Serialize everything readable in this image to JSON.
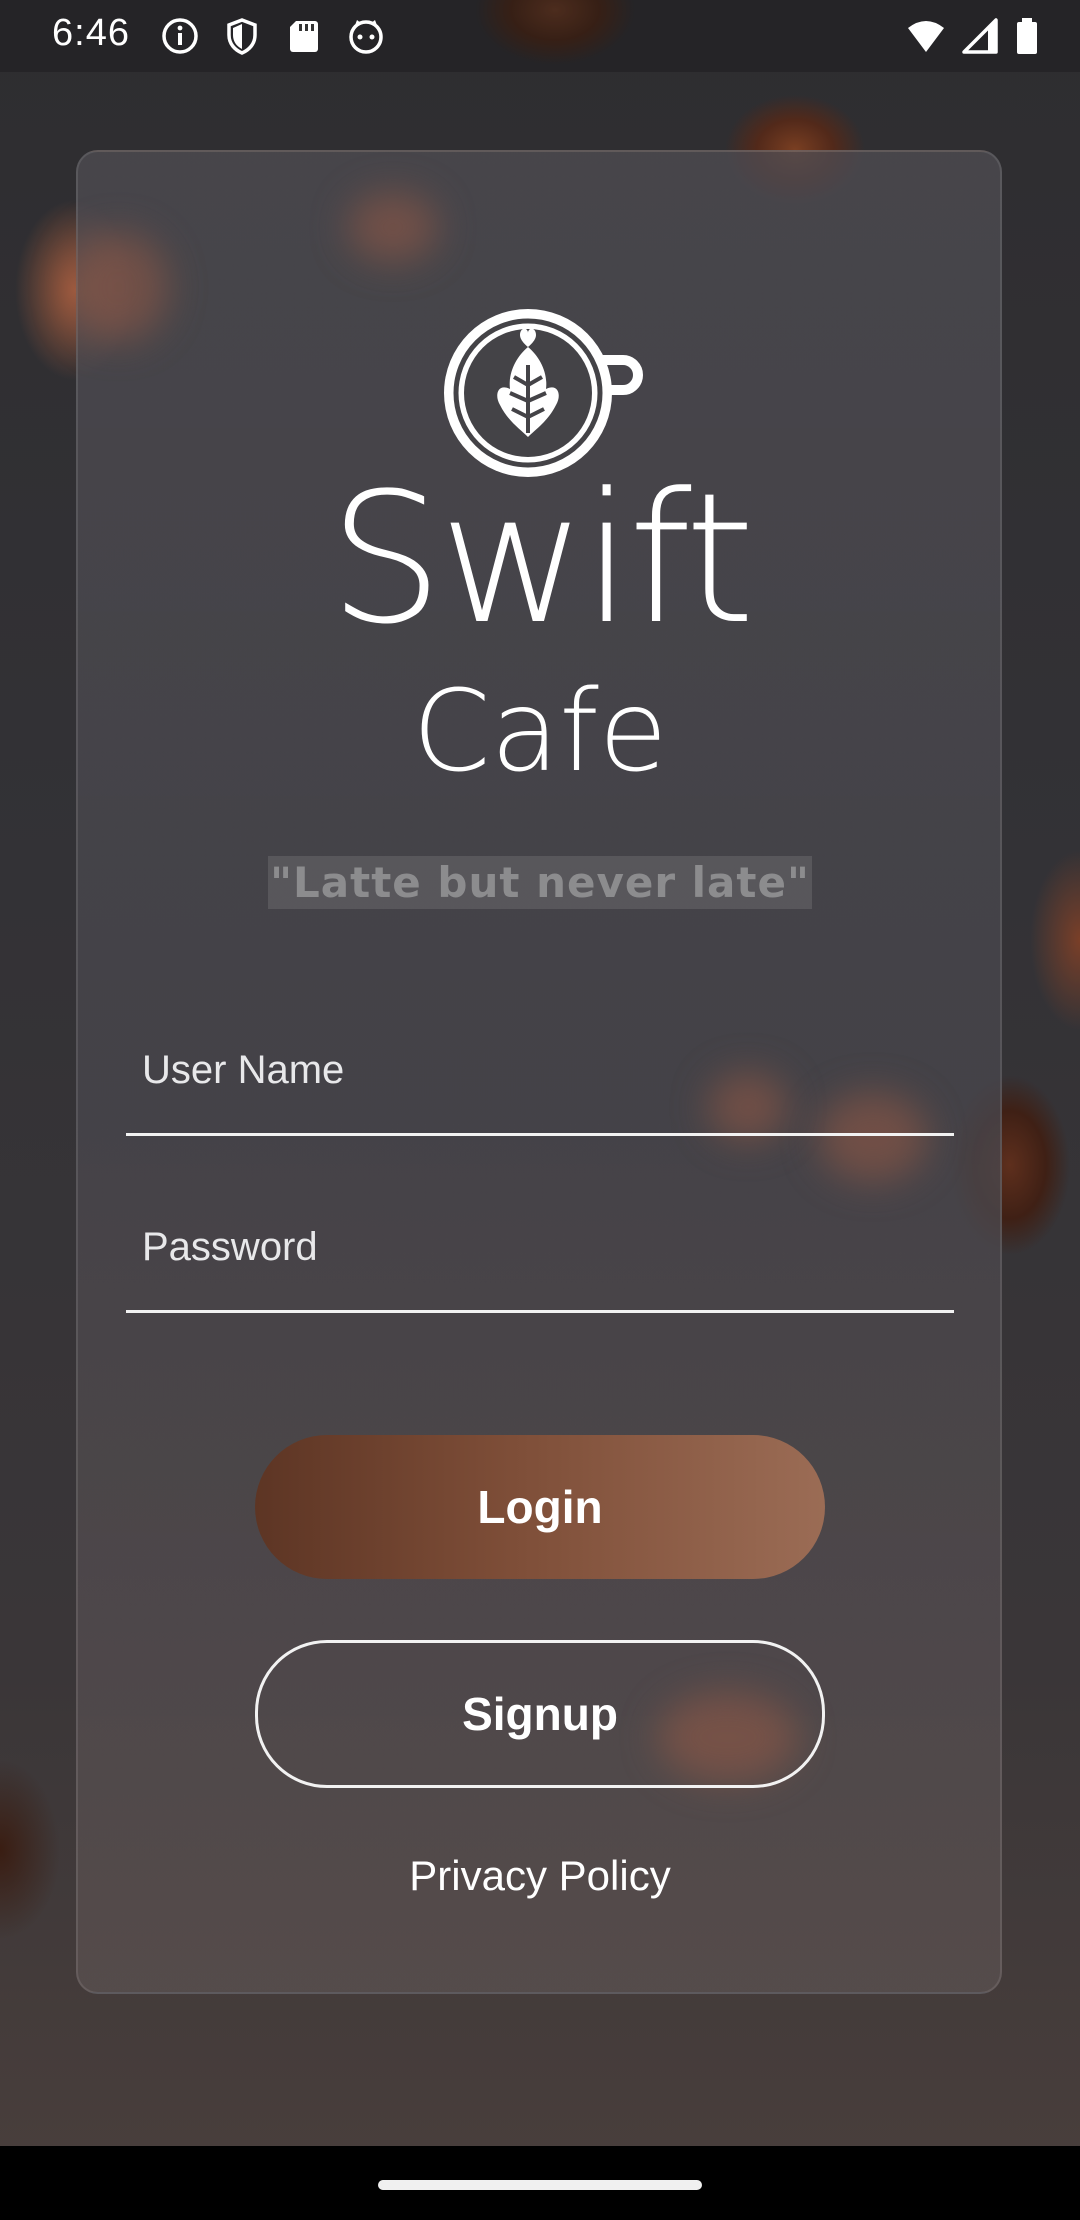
{
  "status_bar": {
    "time": "6:46",
    "left_icons": [
      "info-icon",
      "shield-icon",
      "sd-card-icon",
      "cat-face-icon"
    ],
    "right_icons": [
      "wifi-icon",
      "cell-signal-icon",
      "battery-icon"
    ]
  },
  "brand": {
    "logo_icon": "latte-cup-logo-icon",
    "title": "Swift",
    "subtitle": "Cafe",
    "tagline": "\"Latte but never late\""
  },
  "form": {
    "username_placeholder": "User Name",
    "username_value": "",
    "password_placeholder": "Password",
    "password_value": ""
  },
  "buttons": {
    "login_label": "Login",
    "signup_label": "Signup"
  },
  "links": {
    "privacy_label": "Privacy Policy"
  },
  "colors": {
    "login_gradient_start": "#5d3524",
    "login_gradient_end": "#9b6c55",
    "text": "#ffffff"
  }
}
